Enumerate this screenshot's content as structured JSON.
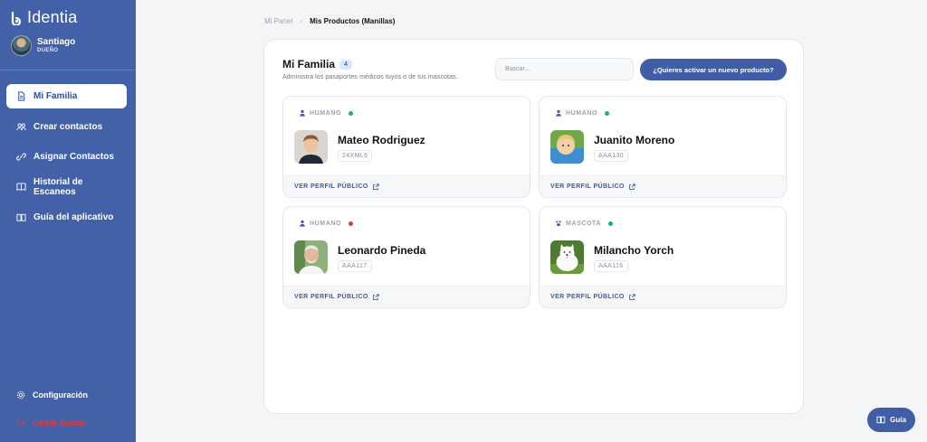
{
  "brand": {
    "name": "Identia"
  },
  "user": {
    "name": "Santiago",
    "role": "DUEÑO"
  },
  "sidebar": {
    "items": [
      {
        "label": "Mi Familia",
        "icon": "document-icon",
        "active": true
      },
      {
        "label": "Crear contactos",
        "icon": "contacts-icon",
        "active": false
      },
      {
        "label": "Asignar Contactos",
        "icon": "link-icon",
        "active": false
      },
      {
        "label": "Historial de Escaneos",
        "icon": "book-icon",
        "active": false
      },
      {
        "label": "Guía del aplicativo",
        "icon": "book-open-icon",
        "active": false
      }
    ],
    "config_label": "Configuración",
    "logout_label": "Cerrar Sesión"
  },
  "breadcrumb": {
    "parent": "Mi Panel",
    "current": "Mis Productos (Manillas)"
  },
  "main": {
    "title": "Mi Familia",
    "count": "4",
    "subtitle": "Administra los pasaportes médicos tuyos o de tus mascotas.",
    "search_placeholder": "Buscar...",
    "activate_label": "¿Quieres activar un nuevo producto?"
  },
  "cards": [
    {
      "type": "HUMANO",
      "status_color": "#16b36b",
      "name": "Mateo Rodriguez",
      "code": "24XML6",
      "link": "VER PERFIL PÚBLICO"
    },
    {
      "type": "HUMANO",
      "status_color": "#16b36b",
      "name": "Juanito Moreno",
      "code": "AAA130",
      "link": "VER PERFIL PÚBLICO"
    },
    {
      "type": "HUMANO",
      "status_color": "#e53935",
      "name": "Leonardo Pineda",
      "code": "AAA117",
      "link": "VER PERFIL PÚBLICO"
    },
    {
      "type": "MASCOTA",
      "status_color": "#16b36b",
      "name": "Milancho Yorch",
      "code": "AAA116",
      "link": "VER PERFIL PÚBLICO"
    }
  ],
  "guide_button": {
    "label": "Guía"
  },
  "colors": {
    "sidebar": "#4361a8",
    "accent": "#3f5ea6",
    "active_status": "#16b36b",
    "inactive_status": "#e53935",
    "logout": "#e53935"
  }
}
